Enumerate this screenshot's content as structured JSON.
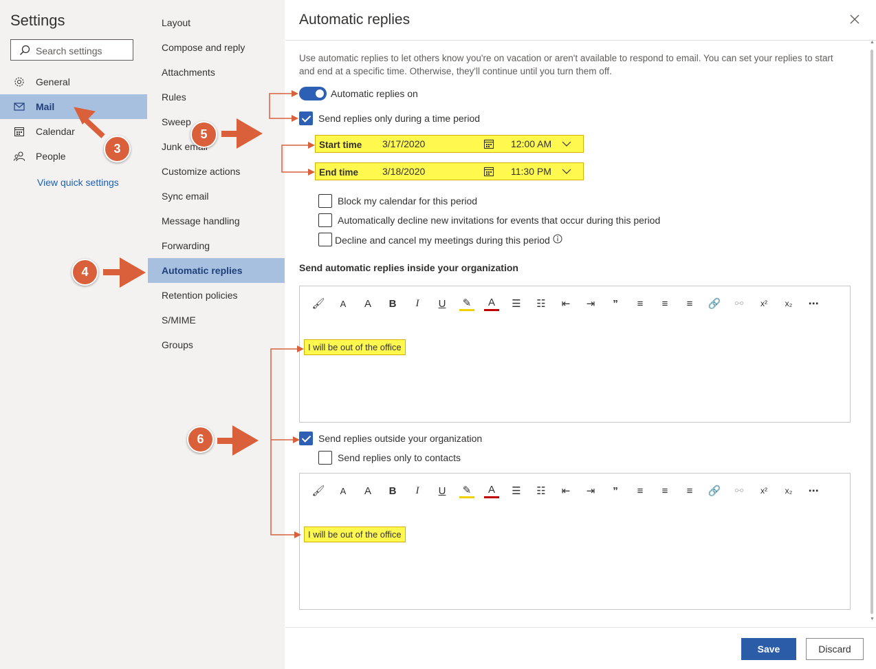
{
  "nav": {
    "title": "Settings",
    "search_placeholder": "Search settings",
    "items": [
      {
        "label": "General",
        "icon": "gear-icon"
      },
      {
        "label": "Mail",
        "icon": "mail-icon"
      },
      {
        "label": "Calendar",
        "icon": "calendar-icon"
      },
      {
        "label": "People",
        "icon": "people-icon"
      }
    ],
    "selected": "Mail",
    "view_quick_settings": "View quick settings"
  },
  "categories": {
    "items": [
      "Layout",
      "Compose and reply",
      "Attachments",
      "Rules",
      "Sweep",
      "Junk email",
      "Customize actions",
      "Sync email",
      "Message handling",
      "Forwarding",
      "Automatic replies",
      "Retention policies",
      "S/MIME",
      "Groups"
    ],
    "selected": "Automatic replies"
  },
  "pane": {
    "title": "Automatic replies",
    "description": "Use automatic replies to let others know you're on vacation or aren't available to respond to email. You can set your replies to start and end at a specific time. Otherwise, they'll continue until you turn them off.",
    "toggle_label": "Automatic replies on",
    "toggle_on": true,
    "time_period_label": "Send replies only during a time period",
    "time_period_checked": true,
    "start": {
      "label": "Start time",
      "date": "3/17/2020",
      "time": "12:00 AM"
    },
    "end": {
      "label": "End time",
      "date": "3/18/2020",
      "time": "11:30 PM"
    },
    "block_calendar": "Block my calendar for this period",
    "decline_invitations": "Automatically decline new invitations for events that occur during this period",
    "decline_meetings": "Decline and cancel my meetings during this period",
    "inside_heading": "Send automatic replies inside your organization",
    "inside_message": "I will be out of the office",
    "outside_label": "Send replies outside your organization",
    "outside_checked": true,
    "contacts_only": "Send replies only to contacts",
    "outside_message": "I will be out of the office",
    "save": "Save",
    "discard": "Discard"
  },
  "toolbar_icons": [
    "format-painter-icon",
    "font-size-icon",
    "font-size-increase-icon",
    "bold-icon",
    "italic-icon",
    "underline-icon",
    "highlight-icon",
    "font-color-icon",
    "bullets-icon",
    "numbering-icon",
    "decrease-indent-icon",
    "increase-indent-icon",
    "quote-icon",
    "align-left-icon",
    "align-center-icon",
    "align-right-icon",
    "link-icon",
    "unlink-icon",
    "superscript-icon",
    "subscript-icon",
    "more-icon"
  ],
  "toolbar_glyphs": [
    "🖌",
    "A",
    "A",
    "B",
    "I",
    "U",
    "✎",
    "A",
    "☰",
    "☷",
    "⇤",
    "⇥",
    "”",
    "≡",
    "≡",
    "≡",
    "🔗",
    "⚯",
    "x²",
    "x₂",
    "⋯"
  ],
  "annotations": {
    "step3": "3",
    "step4": "4",
    "step5": "5",
    "step6": "6"
  },
  "colors": {
    "accent": "#2d5fb4",
    "highlight": "#fff84e",
    "annotation": "#d9603b",
    "selection": "#a8c0e0"
  }
}
